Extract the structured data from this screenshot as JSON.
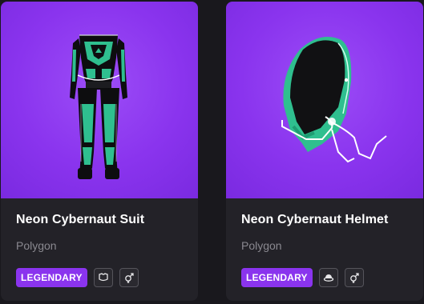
{
  "items": [
    {
      "name": "Neon Cybernaut Suit",
      "creator": "Polygon",
      "rarity": "LEGENDARY",
      "icons": [
        "outfit-category-icon",
        "unisex-gender-icon"
      ]
    },
    {
      "name": "Neon Cybernaut Helmet",
      "creator": "Polygon",
      "rarity": "LEGENDARY",
      "icons": [
        "hat-category-icon",
        "unisex-gender-icon"
      ]
    }
  ],
  "colors": {
    "page_bg": "#19181d",
    "card_bg": "#232228",
    "thumb_bg": "#8a34ee",
    "legendary": "#8a34ee",
    "neon": "#2fbf8f"
  }
}
